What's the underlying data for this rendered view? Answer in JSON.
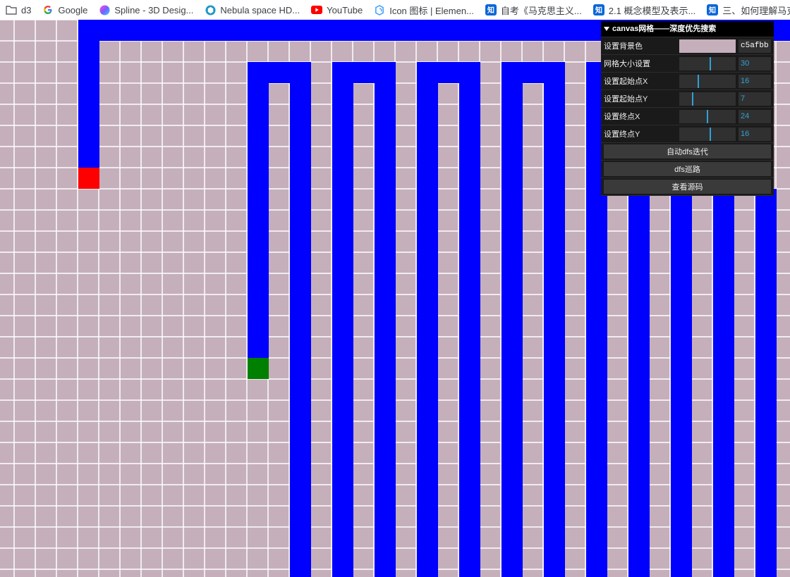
{
  "bookmarks": [
    {
      "icon": "folder-icon",
      "label": "d3"
    },
    {
      "icon": "google-icon",
      "label": "Google"
    },
    {
      "icon": "spline-icon",
      "label": "Spline - 3D Desig..."
    },
    {
      "icon": "nebula-icon",
      "label": "Nebula space HD..."
    },
    {
      "icon": "youtube-icon",
      "label": "YouTube"
    },
    {
      "icon": "element-icon",
      "label": "Icon 图标 | Elemen..."
    },
    {
      "icon": "zhihu-icon",
      "label": "自考《马克思主义..."
    },
    {
      "icon": "zhihu-icon",
      "label": "2.1 概念模型及表示..."
    },
    {
      "icon": "zhihu-icon",
      "label": "三、如何理解马克..."
    }
  ],
  "colors": {
    "background": "#c5afbb",
    "grid_line": "#ffffff",
    "path": "#0000ff",
    "start": "#ff0000",
    "end": "#008000"
  },
  "gui": {
    "title": "canvas网格——深度优先搜索",
    "bg_label": "设置背景色",
    "bg_value": "c5afbb",
    "grid_size_label": "网格大小设置",
    "grid_size_value": "30",
    "start_x_label": "设置起始点X",
    "start_x_value": "16",
    "start_y_label": "设置起始点Y",
    "start_y_value": "7",
    "end_x_label": "设置终点X",
    "end_x_value": "24",
    "end_y_label": "设置终点Y",
    "end_y_value": "16",
    "btn_auto": "自动dfs迭代",
    "btn_patrol": "dfs巡路",
    "btn_source": "查看源码"
  },
  "controls": {
    "grid_size_level": 0.55,
    "start_x_level": 0.33,
    "start_y_level": 0.23,
    "end_x_level": 0.5,
    "end_y_level": 0.55
  }
}
